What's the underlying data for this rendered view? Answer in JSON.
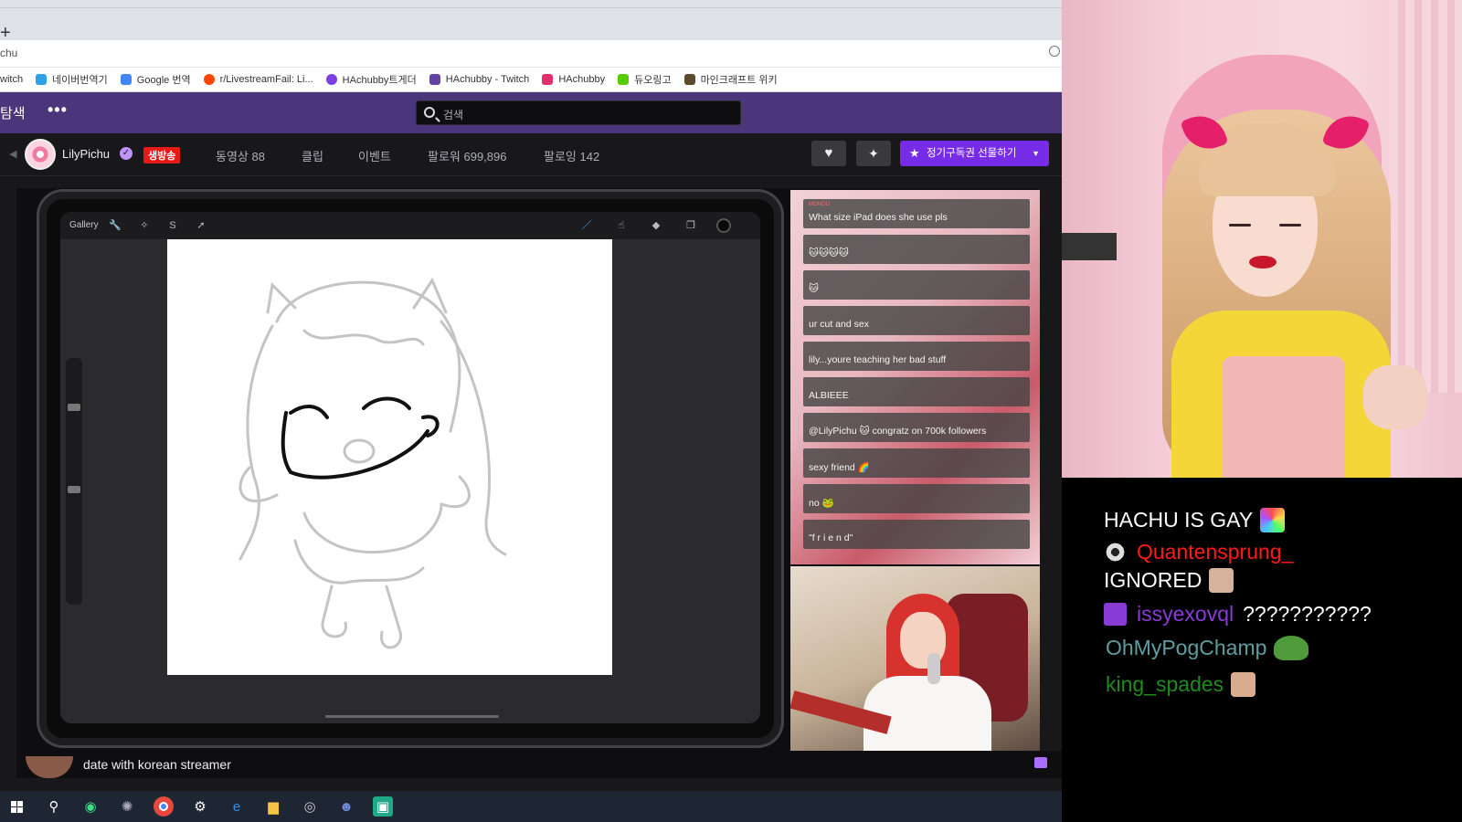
{
  "browser": {
    "new_tab_symbol": "+",
    "address_text": "chu",
    "bookmarks": [
      {
        "label": "witch",
        "color": "#9146ff"
      },
      {
        "label": "네이버번역기",
        "color": "#2fa0e8"
      },
      {
        "label": "Google 번역",
        "color": "#4285f4"
      },
      {
        "label": "r/LivestreamFail: Li...",
        "color": "#ff4500"
      },
      {
        "label": "HAchubby트게더",
        "color": "#7b3fe4"
      },
      {
        "label": "HAchubby - Twitch",
        "color": "#6441a5"
      },
      {
        "label": "HAchubby",
        "color": "#e1306c"
      },
      {
        "label": "듀오링고",
        "color": "#58cc02"
      },
      {
        "label": "마인크래프트 위키",
        "color": "#5d4a2a"
      }
    ]
  },
  "twitch": {
    "header_left": "탐색",
    "more_label": "•••",
    "search_placeholder": "검색",
    "channel": {
      "name": "LilyPichu",
      "live_label": "생방송",
      "tabs": [
        "동영상 88",
        "클립",
        "이벤트",
        "팔로워 699,896",
        "팔로잉 142"
      ],
      "subscribe_label": "정기구독권 선물하기"
    },
    "stream_title": "date with korean streamer"
  },
  "procreate": {
    "gallery_label": "Gallery"
  },
  "stream_chat": {
    "messages": [
      {
        "name": "MONOU",
        "text": "What size iPad does she use pls"
      },
      {
        "name": "",
        "text": "🐱🐱🐱🐱"
      },
      {
        "name": "",
        "text": "🐱"
      },
      {
        "name": "",
        "text": "ur cut and sex"
      },
      {
        "name": "",
        "text": "lily...youre teaching her bad stuff"
      },
      {
        "name": "",
        "text": "ALBIEEE"
      },
      {
        "name": "",
        "text": "@LilyPichu 🐱 congratz on 700k followers"
      },
      {
        "name": "",
        "text": "sexy friend 🌈"
      },
      {
        "name": "",
        "text": "no 🐸"
      },
      {
        "name": "",
        "text": "\"f r i e n d\""
      }
    ]
  },
  "overlay_chat": {
    "lines": [
      {
        "name": "",
        "name_color": "#ffffff",
        "text": "HACHU IS GAY",
        "text_color": "#ffffff",
        "badge": "",
        "emote": "rainbow"
      },
      {
        "name": "Quantensprung_",
        "name_color": "#ff1a1a",
        "text": "",
        "text_color": "#ffffff",
        "badge": "eye",
        "emote": ""
      },
      {
        "name": "",
        "name_color": "#ffffff",
        "text": "IGNORED",
        "text_color": "#ffffff",
        "badge": "",
        "emote": "face"
      },
      {
        "name": "issyexovql",
        "name_color": "#8a3bd6",
        "text": "???????????",
        "text_color": "#ffffff",
        "badge": "purple",
        "emote": ""
      },
      {
        "name": "OhMyPogChamp",
        "name_color": "#5f9ea0",
        "text": "",
        "text_color": "#ffffff",
        "badge": "",
        "emote": "frog"
      },
      {
        "name": "king_spades",
        "name_color": "#1f8b1f",
        "text": "",
        "text_color": "#ffffff",
        "badge": "",
        "emote": "face"
      }
    ]
  },
  "colors": {
    "twitch_purple": "#4b367c",
    "subscribe_button": "#772ce8",
    "live_red": "#e91916"
  }
}
